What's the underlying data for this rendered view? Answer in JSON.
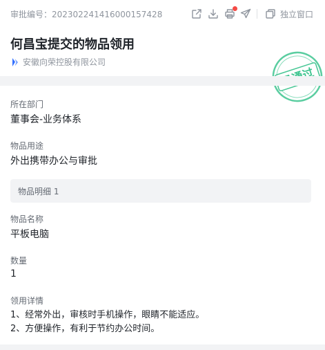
{
  "header": {
    "approval_number": "审批编号：202302241416000157428",
    "standalone_window_label": "独立窗口",
    "toolbar_icons": [
      "share-icon",
      "download-icon",
      "print-icon",
      "forward-icon",
      "standalone-window-icon"
    ],
    "notification_color": "#f54a45"
  },
  "title": "何昌宝提交的物品领用",
  "organization": "安徽向荣控股有限公司",
  "stamp": {
    "text": "已通过",
    "color": "#3dc48f"
  },
  "fields": {
    "department_label": "所在部门",
    "department_value": "董事会-业务体系",
    "purpose_label": "物品用途",
    "purpose_value": "外出携带办公与审批",
    "details_header": "物品明细 1",
    "item_name_label": "物品名称",
    "item_name_value": "平板电脑",
    "quantity_label": "数量",
    "quantity_value": "1",
    "usage_label": "领用详情",
    "usage_lines": [
      "1、经常外出，审核时手机操作，眼睛不能适应。",
      "2、方便操作，有利于节约办公时间。"
    ]
  },
  "colors": {
    "accent_blue": "#3370ff",
    "muted_text": "#8f959e",
    "label_text": "#646a73",
    "band_gray": "#f2f3f5"
  }
}
